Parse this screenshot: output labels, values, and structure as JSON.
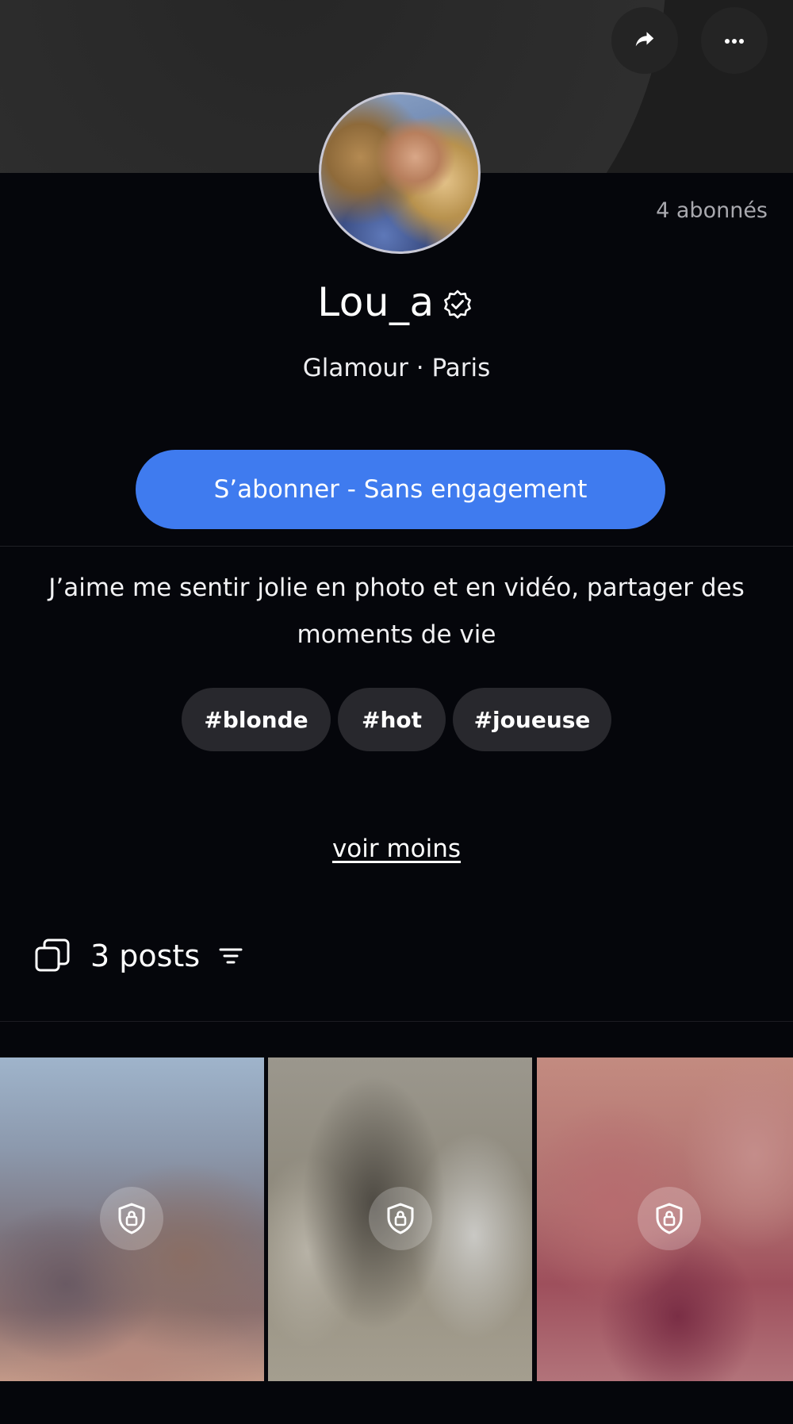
{
  "header": {
    "share_icon": "share-arrow-icon",
    "more_icon": "more-dots-icon",
    "followers": "4 abonnés"
  },
  "profile": {
    "username": "Lou_a",
    "verified_icon": "verified-badge-icon",
    "category": "Glamour · Paris",
    "subscribe_label": "S’abonner - Sans engagement",
    "bio": "J’aime me sentir jolie en photo et en vidéo, partager des moments de vie",
    "tags": [
      "#blonde",
      "#hot",
      "#joueuse"
    ],
    "see_less": "voir moins"
  },
  "posts": {
    "icon": "posts-stack-icon",
    "count_label": "3 posts",
    "filter_icon": "filter-icon",
    "items": [
      {
        "locked": true,
        "lock_icon": "lock-shield-icon"
      },
      {
        "locked": true,
        "lock_icon": "lock-shield-icon"
      },
      {
        "locked": true,
        "lock_icon": "lock-shield-icon"
      }
    ]
  },
  "colors": {
    "background": "#05060b",
    "accent": "#3f7bef",
    "chip": "#28282d",
    "muted_text": "#a8a8ae"
  }
}
